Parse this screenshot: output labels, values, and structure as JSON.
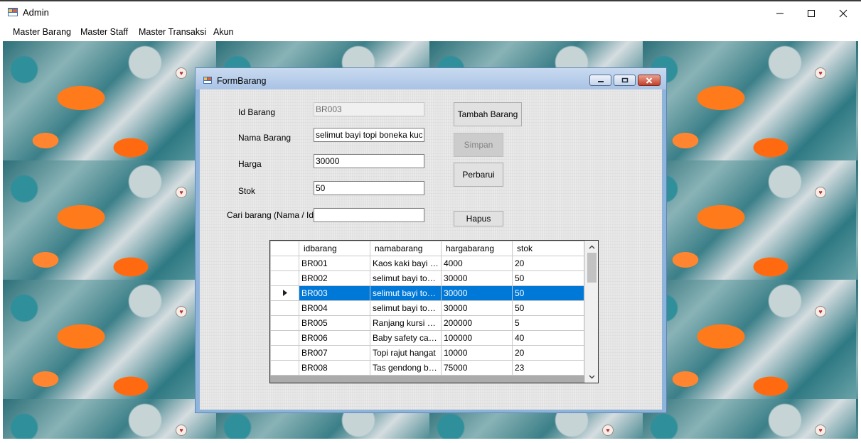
{
  "window": {
    "title": "Admin",
    "icon": "app-icon",
    "controls": [
      "minimize-icon",
      "maximize-icon",
      "close-icon"
    ]
  },
  "menu": {
    "items": [
      "Master Barang",
      "Master Staff",
      "Master Transaksi",
      "Akun"
    ]
  },
  "form": {
    "title": "FormBarang",
    "labels": {
      "id": "Id Barang",
      "nama": "Nama Barang",
      "harga": "Harga",
      "stok": "Stok",
      "cari": "Cari barang (Nama / Id)"
    },
    "fields": {
      "id": "BR003",
      "nama": "selimut bayi topi boneka kucing",
      "harga": "30000",
      "stok": "50",
      "cari": ""
    },
    "buttons": {
      "tambah": "Tambah Barang",
      "simpan": "Simpan",
      "perbarui": "Perbarui",
      "hapus": "Hapus"
    }
  },
  "grid": {
    "columns": [
      "idbarang",
      "namabarang",
      "hargabarang",
      "stok"
    ],
    "selected_index": 2,
    "rows": [
      [
        "BR001",
        "Kaos kaki bayi lucu",
        "4000",
        "20"
      ],
      [
        "BR002",
        "selimut bayi topi b...",
        "30000",
        "50"
      ],
      [
        "BR003",
        "selimut bayi topi b...",
        "30000",
        "50"
      ],
      [
        "BR004",
        "selimut bayi topi b...",
        "30000",
        "50"
      ],
      [
        "BR005",
        "Ranjang kursi bayi",
        "200000",
        "5"
      ],
      [
        "BR006",
        "Baby safety car s...",
        "100000",
        "40"
      ],
      [
        "BR007",
        "Topi rajut hangat",
        "10000",
        "20"
      ],
      [
        "BR008",
        "Tas gendong bay...",
        "75000",
        "23"
      ]
    ]
  },
  "colors": {
    "selection": "#0078d7",
    "mdi_frame": "#8fb4dc",
    "form_bg": "#e4e4e4"
  }
}
